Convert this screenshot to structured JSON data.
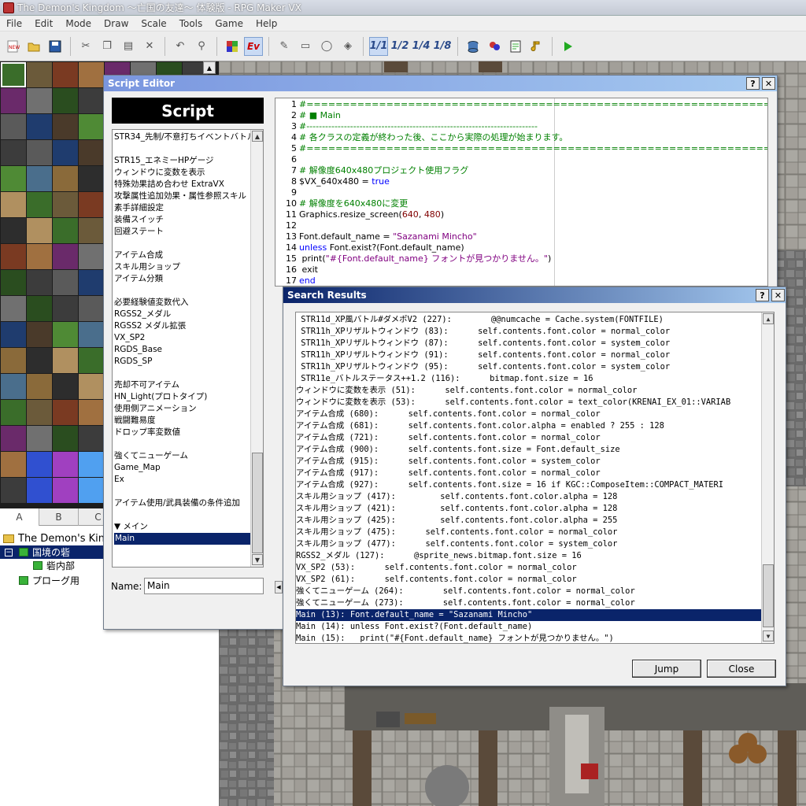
{
  "window": {
    "title": "The Demon's Kingdom ～亡国の友達～ 体験版 - RPG Maker VX"
  },
  "menu": [
    "File",
    "Edit",
    "Mode",
    "Draw",
    "Scale",
    "Tools",
    "Game",
    "Help"
  ],
  "toolbar": {
    "items": [
      "new-icon",
      "open-icon",
      "save-icon",
      "cut-icon",
      "copy-icon",
      "paste-icon",
      "delete-icon",
      "undo-icon",
      "search-icon",
      "map-layer-icon",
      "event-layer-icon",
      "pencil-icon",
      "rectangle-icon",
      "ellipse-icon",
      "fill-icon",
      "scale-1-1",
      "scale-1-2",
      "scale-1-4",
      "scale-1-8",
      "database-icon",
      "material-icon",
      "script-editor-icon",
      "sound-test-icon",
      "play-icon"
    ],
    "scale_labels": [
      "1/1",
      "1/2",
      "1/4",
      "1/8"
    ],
    "ev_label": "Ev"
  },
  "tile_tabs": [
    "A",
    "B",
    "C"
  ],
  "map_tree": {
    "project": "The Demon's Kingdom",
    "items": [
      "国境の砦",
      "砦内部",
      "プローグ用"
    ]
  },
  "script_editor": {
    "title": "Script Editor",
    "header": "Script",
    "name_label": "Name:",
    "name_value": "Main",
    "help_btn": "?",
    "close_btn": "✕",
    "scripts": [
      "STR34_先制/不意打ちイベントバトル",
      "",
      "STR15_エネミーHPゲージ",
      "ウィンドウに変数を表示",
      "特殊効果詰め合わせ ExtraVX",
      "攻撃属性追加効果・属性参照スキル",
      "素手詳細設定",
      "装備スイッチ",
      "回避ステート",
      "",
      "アイテム合成",
      "スキル用ショップ",
      "アイテム分類",
      "",
      "必要経験値変数代入",
      "RGSS2_メダル",
      "RGSS2 メダル拡張",
      "VX_SP2",
      "RGDS_Base",
      "RGDS_SP",
      "",
      "売却不可アイテム",
      "HN_Light(プロトタイプ)",
      "使用側アニメーション",
      "戦闘難易度",
      "ドロップ率変数値",
      "",
      "強くてニューゲーム",
      "Game_Map",
      "Ex",
      "",
      "アイテム使用/武具装備の条件追加",
      "",
      "▼ メイン",
      "Main"
    ],
    "selected_index": 34,
    "code": [
      {
        "n": "1",
        "t": "#==========================================================================",
        "c": "cm"
      },
      {
        "n": "2",
        "t": "# ■ Main",
        "c": "cm"
      },
      {
        "n": "3",
        "t": "#--------------------------------------------------------------------------",
        "c": "cm"
      },
      {
        "n": "4",
        "t": "#  各クラスの定義が終わった後、ここから実際の処理が始まります。",
        "c": "cm"
      },
      {
        "n": "5",
        "t": "#==========================================================================",
        "c": "cm"
      },
      {
        "n": "6",
        "t": "",
        "c": ""
      },
      {
        "n": "7",
        "t": "# 解像度640x480プロジェクト使用フラグ",
        "c": "cm"
      },
      {
        "n": "8",
        "t": "$VX_640x480 = true",
        "c": "mix8"
      },
      {
        "n": "9",
        "t": "",
        "c": ""
      },
      {
        "n": "10",
        "t": "# 解像度を640x480に変更",
        "c": "cm"
      },
      {
        "n": "11",
        "t": "Graphics.resize_screen(640, 480)",
        "c": "mix11"
      },
      {
        "n": "12",
        "t": "",
        "c": ""
      },
      {
        "n": "13",
        "t": "Font.default_name = \"Sazanami Mincho\"",
        "c": "mix13"
      },
      {
        "n": "14",
        "t": "unless Font.exist?(Font.default_name)",
        "c": "mix14"
      },
      {
        "n": "15",
        "t": "  print(\"#{Font.default_name} フォントが見つかりません。\")",
        "c": "st"
      },
      {
        "n": "16",
        "t": "  exit",
        "c": ""
      },
      {
        "n": "17",
        "t": "end",
        "c": "kw"
      }
    ]
  },
  "search_results": {
    "title": "Search Results",
    "help_btn": "?",
    "close_btn": "✕",
    "results": [
      " STR11d_XP風バトル#ダメポV2 (227):        @@numcache = Cache.system(FONTFILE)",
      " STR11h_XPリザルトウィンドウ (83):      self.contents.font.color = normal_color",
      " STR11h_XPリザルトウィンドウ (87):      self.contents.font.color = system_color",
      " STR11h_XPリザルトウィンドウ (91):      self.contents.font.color = normal_color",
      " STR11h_XPリザルトウィンドウ (95):      self.contents.font.color = system_color",
      " STR11e_バトルステータス++1.2 (116):      bitmap.font.size = 16",
      "ウィンドウに変数を表示 (51):      self.contents.font.color = normal_color",
      "ウィンドウに変数を表示 (53):      self.contents.font.color = text_color(KRENAI_EX_01::VARIAB",
      "アイテム合成 (680):      self.contents.font.color = normal_color",
      "アイテム合成 (681):      self.contents.font.color.alpha = enabled ? 255 : 128",
      "アイテム合成 (721):      self.contents.font.color = normal_color",
      "アイテム合成 (900):      self.contents.font.size = Font.default_size",
      "アイテム合成 (915):      self.contents.font.color = system_color",
      "アイテム合成 (917):      self.contents.font.color = normal_color",
      "アイテム合成 (927):      self.contents.font.size = 16 if KGC::ComposeItem::COMPACT_MATERI",
      "スキル用ショップ (417):         self.contents.font.color.alpha = 128",
      "スキル用ショップ (421):         self.contents.font.color.alpha = 128",
      "スキル用ショップ (425):         self.contents.font.color.alpha = 255",
      "スキル用ショップ (475):      self.contents.font.color = normal_color",
      "スキル用ショップ (477):      self.contents.font.color = system_color",
      "RGSS2_メダル (127):      @sprite_news.bitmap.font.size = 16",
      "VX_SP2 (53):      self.contents.font.color = normal_color",
      "VX_SP2 (61):      self.contents.font.color = normal_color",
      "強くてニューゲーム (264):        self.contents.font.color = normal_color",
      "強くてニューゲーム (273):        self.contents.font.color = normal_color",
      "Main (13): Font.default_name = \"Sazanami Mincho\"",
      "Main (14): unless Font.exist?(Font.default_name)",
      "Main (15):   print(\"#{Font.default_name} フォントが見つかりません。\")"
    ],
    "selected_index": 25,
    "jump_label": "Jump",
    "close_label": "Close"
  },
  "colors": {
    "title_active": "#0a246a",
    "title_active_end": "#a6caf0",
    "title_inactive": "#7a96df",
    "selection": "#0a246a"
  }
}
